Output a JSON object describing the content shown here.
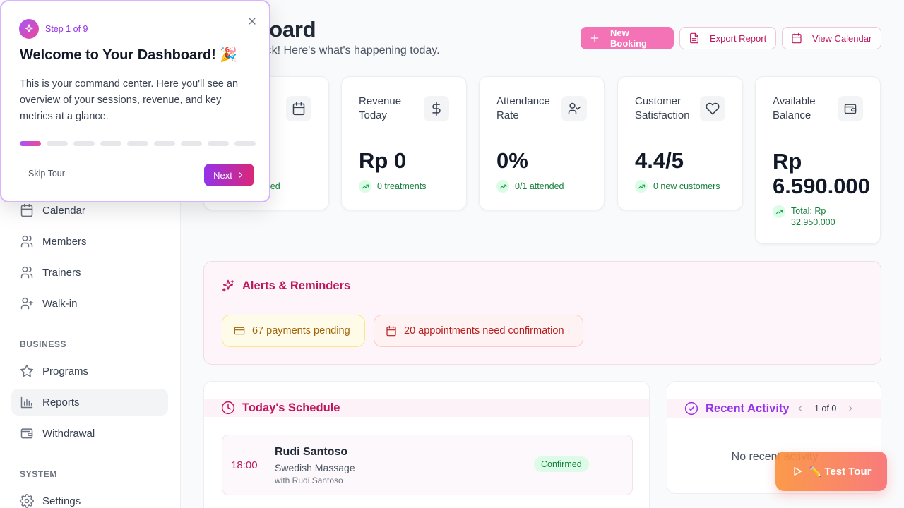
{
  "sidebar": {
    "items": [
      {
        "label": "Calendar"
      },
      {
        "label": "Members"
      },
      {
        "label": "Trainers"
      },
      {
        "label": "Walk-in"
      }
    ],
    "business_section": "BUSINESS",
    "business_items": [
      {
        "label": "Programs"
      },
      {
        "label": "Reports",
        "active": true
      },
      {
        "label": "Withdrawal"
      }
    ],
    "system_section": "SYSTEM",
    "system_items": [
      {
        "label": "Settings"
      }
    ]
  },
  "header": {
    "title": "Dashboard",
    "subtitle": "Welcome back! Here's what's happening today.",
    "new_booking_label": "New Booking",
    "export_label": "Export Report",
    "calendar_label": "View Calendar"
  },
  "stats": [
    {
      "label": "",
      "value": "",
      "sub": "completed",
      "icon": "calendar-icon"
    },
    {
      "label": "Revenue Today",
      "value": "Rp 0",
      "sub": "0 treatments",
      "icon": "dollar-icon"
    },
    {
      "label": "Attendance Rate",
      "value": "0%",
      "sub": "0/1 attended",
      "icon": "user-check-icon"
    },
    {
      "label": "Customer Satisfaction",
      "value": "4.4/5",
      "sub": "0 new customers",
      "icon": "heart-icon"
    },
    {
      "label": "Available Balance",
      "value": "Rp 6.590.000",
      "sub": "Total: Rp 32.950.000",
      "icon": "wallet-icon"
    }
  ],
  "alerts": {
    "title": "Alerts & Reminders",
    "payments": "67 payments pending",
    "appointments": "20 appointments need confirmation"
  },
  "schedule": {
    "title": "Today's Schedule",
    "sessions": [
      {
        "time": "18:00",
        "name": "Rudi Santoso",
        "service": "Swedish Massage",
        "with": "with Rudi Santoso",
        "status": "Confirmed"
      }
    ]
  },
  "activity": {
    "title": "Recent Activity",
    "pager": "1 of 0",
    "empty": "No recent activity"
  },
  "test_tour": {
    "label": "✏️ Test Tour"
  },
  "tour": {
    "step": "Step 1 of 9",
    "title": "Welcome to Your Dashboard! 🎉",
    "body": "This is your command center. Here you'll see an overview of your sessions, revenue, and key metrics at a glance.",
    "total_steps": 9,
    "current_step": 1,
    "skip_label": "Skip Tour",
    "next_label": "Next"
  },
  "colors": {
    "primary": "#f472b6",
    "accent": "#be185d",
    "purple": "#9333ea",
    "success": "#15803d"
  }
}
